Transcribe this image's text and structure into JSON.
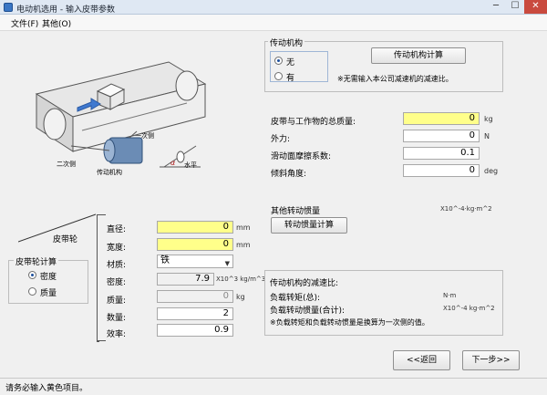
{
  "window": {
    "title": "电动机选用 - 输入皮带参数",
    "minimize": "─",
    "maximize": "☐",
    "close": "✕"
  },
  "menu": {
    "file": "文件(F)",
    "other": "其他(O)"
  },
  "diagram": {
    "secondary_side": "一次侧",
    "secondary_side_2": "二次侧",
    "transmission": "传动机构",
    "alpha": "α",
    "horizontal": "水平"
  },
  "mechanism": {
    "group_title": "传动机构",
    "option_none": "无",
    "option_yes": "有",
    "calc_button": "传动机构计算",
    "note": "※无需输入本公司减速机的减速比。"
  },
  "load": {
    "mass_label": "皮带与工作物的总质量:",
    "mass_value": "0",
    "mass_unit": "kg",
    "force_label": "外力:",
    "force_value": "0",
    "force_unit": "N",
    "friction_label": "滑动面摩擦系数:",
    "friction_value": "0.1",
    "incline_label": "倾斜角度:",
    "incline_value": "0",
    "incline_unit": "deg"
  },
  "other_inertia": {
    "label": "其他转动惯量",
    "unit": "X10^-4·kg·m^2",
    "calc_button": "转动惯量计算"
  },
  "pulley": {
    "section_label": "皮带轮",
    "diameter_label": "直径:",
    "diameter_value": "0",
    "diameter_unit": "mm",
    "width_label": "宽度:",
    "width_value": "0",
    "width_unit": "mm",
    "material_label": "材质:",
    "material_value": "铁",
    "density_label": "密度:",
    "density_value": "7.9",
    "density_unit": "X10^3 kg/m^3",
    "mass_label": "质量:",
    "mass_value": "0",
    "mass_unit": "kg",
    "qty_label": "数量:",
    "qty_value": "2",
    "efficiency_label": "效率:",
    "efficiency_value": "0.9"
  },
  "pulley_calc": {
    "group_title": "皮带轮计算",
    "option_density": "密度",
    "option_mass": "质量"
  },
  "result": {
    "ratio_label": "传动机构的减速比:",
    "torque_label": "负载转矩(总):",
    "torque_unit": "N·m",
    "inertia_label": "负载转动惯量(合计):",
    "inertia_unit": "X10^-4 kg·m^2",
    "note": "※负载转矩和负载转动惯量是换算为一次侧的值。"
  },
  "nav": {
    "back": "<<返回",
    "next": "下一步>>"
  },
  "status": {
    "text": "请务必输入黄色项目。"
  }
}
